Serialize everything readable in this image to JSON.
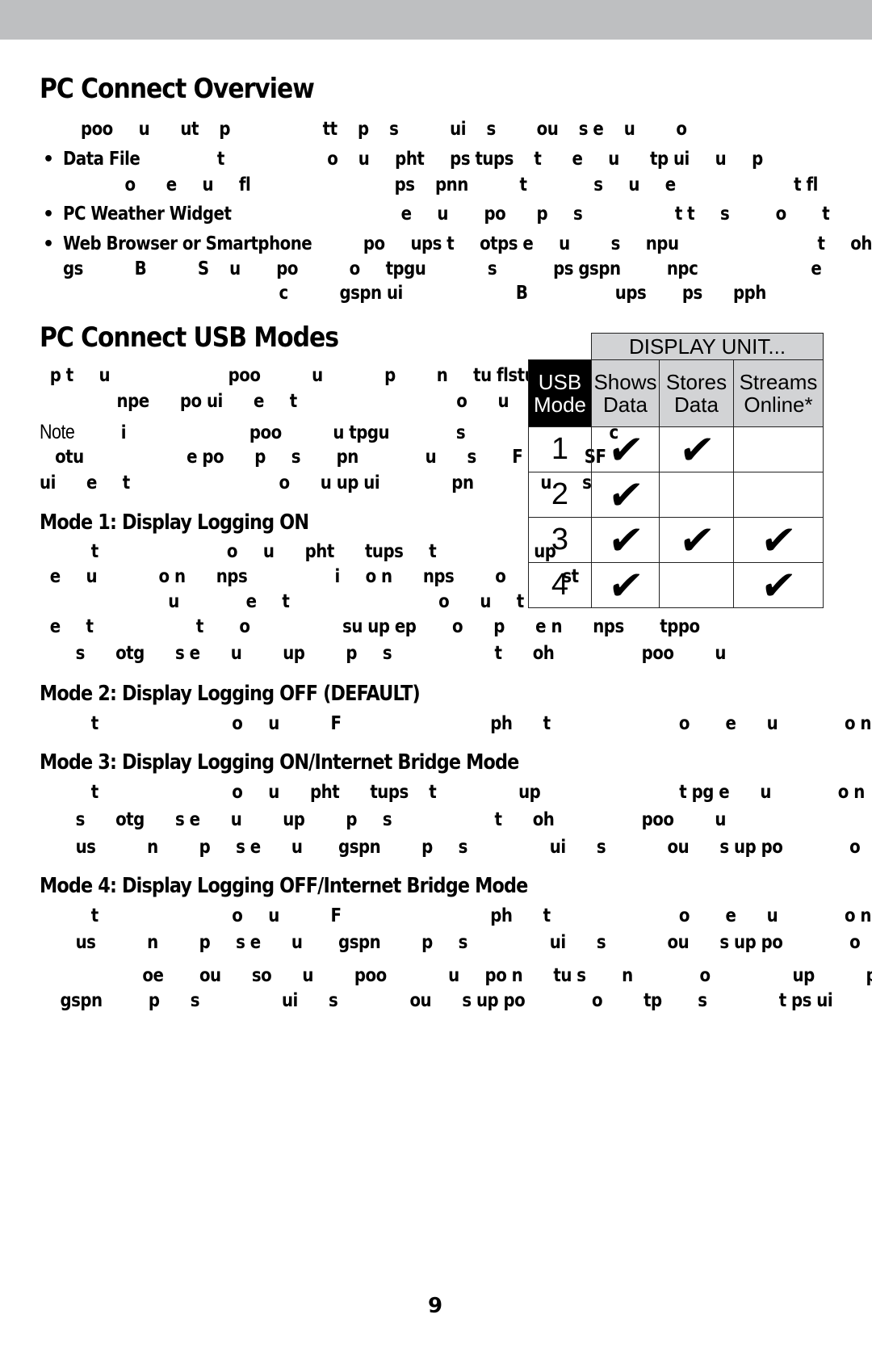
{
  "header_bar": {
    "color": "#bebfc1"
  },
  "overview": {
    "title": "PC Connect Overview",
    "intro_lines": [
      "        poo     u      ut    p                  tt    p    s          ui    s        ou    s e    u        o"
    ],
    "bullets": [
      {
        "lead": "Data File",
        "lines": [
          "               t                    o    u     pht     ps tups    t      e     u      tp ui     u     p",
          "            o      e     u     fl                            ps    pnn          t             s     u     e                       t fl"
        ]
      },
      {
        "lead": "PC Weather Widget",
        "lines": [
          "                                 e     u       po      p     s                  t t     s         o       t                  eh"
        ]
      },
      {
        "lead": "Web Browser or Smartphone",
        "lines": [
          "          po     ups t     otps e     u        s     npu                           t     oh B",
          "gs          B          S    u       po          o     tpgu            s           ps gspn         npc                      e",
          "                                          c          gspn ui                      B                 ups       ps      pph"
        ]
      }
    ]
  },
  "usb_modes": {
    "title": "PC Connect USB Modes",
    "intro_lines": [
      "  p t     u                       poo          u            p        n     tu flstu",
      "               npe      po ui      e     t                               o      u"
    ],
    "note": {
      "label": "Note",
      "lines": [
        "         i                        poo          u tpgu             s                            c",
        "   otu                    e po      p     s       pn             u      s       F            SF",
        "ui      e     t                             o      u up ui              pn             u      s"
      ]
    },
    "table": {
      "group_header": "DISPLAY UNIT...",
      "corner_header": [
        "USB",
        "Mode"
      ],
      "columns": [
        {
          "line1": "Shows",
          "line2": "Data"
        },
        {
          "line1": "Stores",
          "line2": "Data"
        },
        {
          "line1": "Streams",
          "line2": "Online*"
        }
      ],
      "rows": [
        {
          "mode": "1",
          "shows": true,
          "stores": true,
          "streams": false
        },
        {
          "mode": "2",
          "shows": true,
          "stores": false,
          "streams": false
        },
        {
          "mode": "3",
          "shows": true,
          "stores": true,
          "streams": true
        },
        {
          "mode": "4",
          "shows": true,
          "stores": false,
          "streams": true
        }
      ],
      "check_glyph": "✔"
    }
  },
  "modes": [
    {
      "title": "Mode 1: Display Logging ON",
      "lines": [
        "          t                         o     u      pht      tups     t                   up",
        "  e     u            o n      nps                 i     o n      nps        o           st",
        "                         u             e     t                             o      u     t",
        "  e     t                    t       o                  su up ep       o      p      e n      nps       tppo",
        "       s      otg      s e      u        up        p     s                    t      oh                 poo        u"
      ]
    },
    {
      "title": "Mode 2: Display Logging OFF (DEFAULT)",
      "lines": [
        "          t                          o     u          F                             ph      t                         o       e      u             o n     nps"
      ]
    },
    {
      "title": "Mode 3: Display Logging ON/Internet Bridge Mode",
      "lines": [
        "          t                          o     u      pht      tups    t                up                           t pg e      u             o n     n",
        "       s      otg      s e      u        up        p     s                    t      oh                 poo        u",
        "       us          n        p     s e      u       gspn        p     s                ui      s            ou      s up po             o       tp      s"
      ]
    },
    {
      "title": "Mode 4: Display Logging OFF/Internet Bridge Mode",
      "lines": [
        "          t                          o     u          F                             ph      t                         o       e      u             o n     nps",
        "       us          n        p     s e      u       gspn        p     s                ui      s            ou      s up po             o       tp      s"
      ]
    }
  ],
  "footnote_lines": [
    "                    oe       ou      so      u        poo            u     po n      tu s       n             o                up          pou       o        p",
    "    gspn         p      s                ui      s              ou      s up po             o        tp       s              t ps ui        B            S      u"
  ],
  "page_number": "9"
}
